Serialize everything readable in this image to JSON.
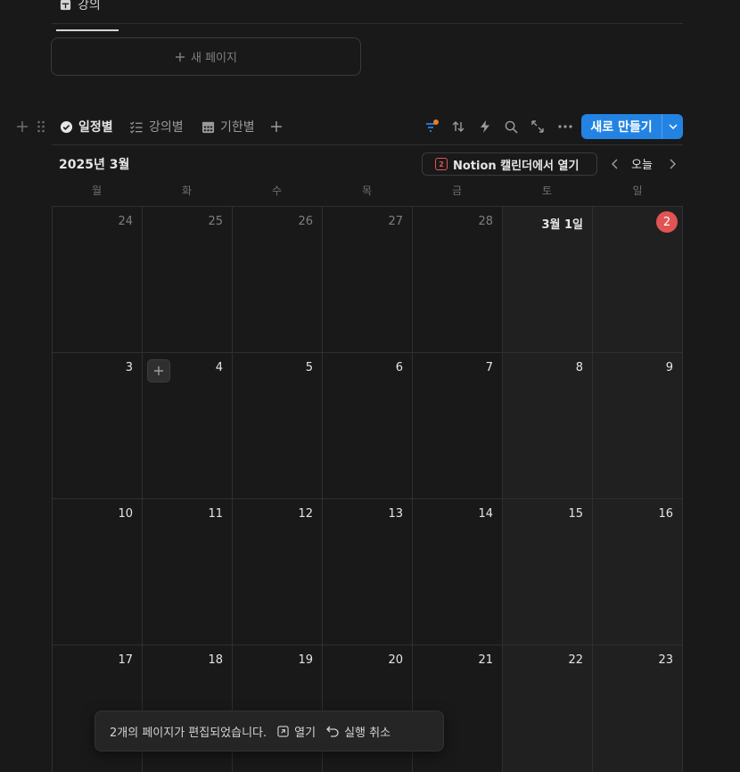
{
  "top_item": {
    "label": "강의",
    "icon": "page-stack-icon"
  },
  "new_page": {
    "label": "새 페이지",
    "icon": "plus-icon"
  },
  "views": [
    {
      "label": "일정별",
      "icon": "check-circle-icon",
      "active": true
    },
    {
      "label": "강의별",
      "icon": "checklist-icon",
      "active": false
    },
    {
      "label": "기한별",
      "icon": "calendar-grid-icon",
      "active": false
    }
  ],
  "toolbar": {
    "icons": [
      "filter-icon",
      "sort-icon",
      "automation-icon",
      "search-icon",
      "expand-icon",
      "more-icon"
    ],
    "filter_dot_color": "#e67e22",
    "new_label": "새로 만들기"
  },
  "calendar": {
    "month_title": "2025년 3월",
    "open_in_calendar": "Notion 캘린더에서 열기",
    "calendar_badge": "2",
    "today_label": "오늘",
    "weekdays": [
      "월",
      "화",
      "수",
      "목",
      "금",
      "토",
      "일"
    ],
    "weeks": [
      [
        "24",
        "25",
        "26",
        "27",
        "28",
        "3월 1일",
        "2"
      ],
      [
        "3",
        "4",
        "5",
        "6",
        "7",
        "8",
        "9"
      ],
      [
        "10",
        "11",
        "12",
        "13",
        "14",
        "15",
        "16"
      ],
      [
        "17",
        "18",
        "19",
        "20",
        "21",
        "22",
        "23"
      ]
    ],
    "accent_color": "#2383e2",
    "today_color": "#e05454"
  },
  "toast": {
    "message": "2개의 페이지가 편집되었습니다.",
    "open_label": "열기",
    "undo_label": "실행 취소"
  }
}
